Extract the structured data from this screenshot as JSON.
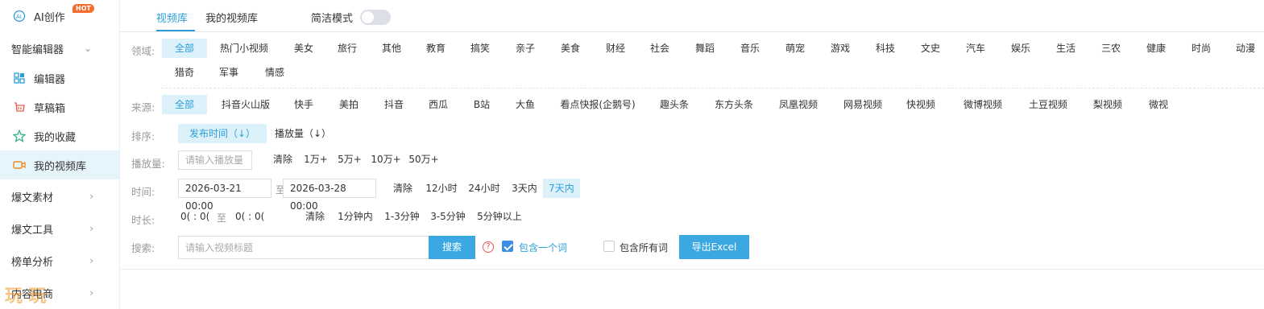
{
  "sidebar": {
    "ai_label": "AI创作",
    "hot_badge": "HOT",
    "section1": "智能编辑器",
    "items": [
      {
        "label": "编辑器"
      },
      {
        "label": "草稿箱"
      },
      {
        "label": "我的收藏"
      },
      {
        "label": "我的视频库"
      }
    ],
    "sections": [
      "爆文素材",
      "爆文工具",
      "榜单分析",
      "内容电商"
    ]
  },
  "tabs": {
    "video_library": "视频库",
    "my_video_library": "我的视频库",
    "simple_mode": "简洁模式"
  },
  "filters": {
    "domain_label": "领域:",
    "domains_row1": [
      "全部",
      "热门小视频",
      "美女",
      "旅行",
      "其他",
      "教育",
      "搞笑",
      "亲子",
      "美食",
      "财经",
      "社会",
      "舞蹈",
      "音乐",
      "萌宠",
      "游戏",
      "科技",
      "文史",
      "汽车",
      "娱乐",
      "生活",
      "三农",
      "健康",
      "时尚",
      "动漫"
    ],
    "domains_row2": [
      "猎奇",
      "军事",
      "情感"
    ],
    "source_label": "来源:",
    "sources": [
      "全部",
      "抖音火山版",
      "快手",
      "美拍",
      "抖音",
      "西瓜",
      "B站",
      "大鱼",
      "看点快报(企鹅号)",
      "趣头条",
      "东方头条",
      "凤凰视频",
      "网易视频",
      "快视频",
      "微博视频",
      "土豆视频",
      "梨视频",
      "微视"
    ],
    "sort_label": "排序:",
    "sort_publish": "发布时间（↓）",
    "sort_plays": "播放量（↓）",
    "plays_label": "播放量:",
    "plays_placeholder": "请输入播放量",
    "plays_options": [
      "清除",
      "1万+",
      "5万+",
      "10万+",
      "50万+"
    ],
    "time_label": "时间:",
    "time_start": "2026-03-21 00:00",
    "time_to": "至",
    "time_end": "2026-03-28 00:00",
    "time_options": [
      "清除",
      "12小时",
      "24小时",
      "3天内",
      "7天内"
    ],
    "duration_label": "时长:",
    "duration_from": "0(  :  0(",
    "duration_to": "至",
    "duration_end": "0(  :  0(",
    "duration_options": [
      "清除",
      "1分钟内",
      "1-3分钟",
      "3-5分钟",
      "5分钟以上"
    ],
    "search_label": "搜索:",
    "search_placeholder": "请输入视频标题",
    "search_button": "搜索",
    "contain_one": "包含一个词",
    "contain_all": "包含所有词",
    "export_button": "导出Excel"
  },
  "watermark": "玩 玩"
}
